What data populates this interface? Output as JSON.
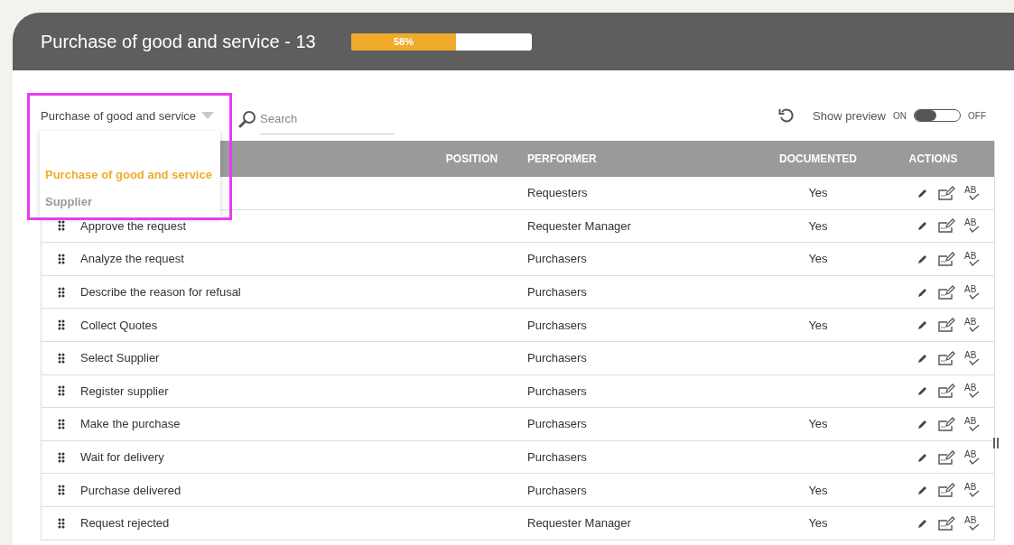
{
  "header": {
    "title": "Purchase of good and service - 13",
    "progress": {
      "level": 0.58,
      "label": "58%"
    }
  },
  "toolbar": {
    "dropdown": {
      "value": "Purchase of good and service",
      "expanded": true,
      "options": [
        {
          "label": "Purchase of good and service",
          "selected": true
        },
        {
          "label": "Supplier",
          "selected": false
        }
      ]
    },
    "search": {
      "placeholder": "Search"
    },
    "preview": {
      "label": "Show preview",
      "on_label": "ON",
      "off_label": "OFF",
      "on": true
    }
  },
  "table": {
    "columns": [
      "POSITION",
      "PERFORMER",
      "DOCUMENTED",
      "ACTIONS"
    ],
    "rows": [
      {
        "performer": "Requesters",
        "documented": "Yes",
        "spellcheck": "AB"
      },
      {
        "name": "Approve the request",
        "performer": "Requester Manager",
        "documented": "Yes",
        "spellcheck": "AB"
      },
      {
        "name": "Analyze the request",
        "performer": "Purchasers",
        "documented": "Yes",
        "spellcheck": "AB"
      },
      {
        "name": "Describe the reason for refusal",
        "performer": "Purchasers",
        "spellcheck": "AB"
      },
      {
        "name": "Collect Quotes",
        "performer": "Purchasers",
        "documented": "Yes",
        "spellcheck": "AB"
      },
      {
        "name": "Select Supplier",
        "performer": "Purchasers",
        "spellcheck": "AB"
      },
      {
        "name": "Register supplier",
        "performer": "Purchasers",
        "spellcheck": "AB"
      },
      {
        "name": "Make the purchase",
        "performer": "Purchasers",
        "documented": "Yes",
        "spellcheck": "AB"
      },
      {
        "name": "Wait for delivery",
        "performer": "Purchasers",
        "spellcheck": "AB"
      },
      {
        "name": "Purchase delivered",
        "performer": "Purchasers",
        "documented": "Yes",
        "spellcheck": "AB"
      },
      {
        "name": "Request rejected",
        "performer": "Requester Manager",
        "documented": "Yes",
        "spellcheck": "AB"
      }
    ]
  }
}
